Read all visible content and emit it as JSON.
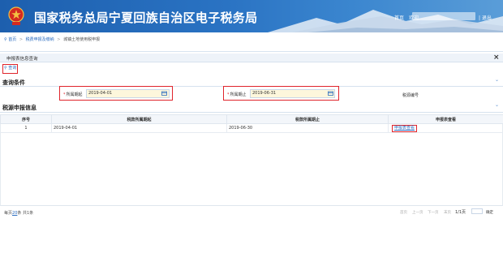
{
  "header": {
    "title": "国家税务总局宁夏回族自治区电子税务局",
    "nav_home": "首页",
    "nav_user": "欢迎",
    "nav_exit": "| 退出"
  },
  "breadcrumb": {
    "items": [
      "首页",
      "税费申报及缴纳",
      "城镇土地使用税申报"
    ]
  },
  "panel": {
    "title": "申报表信息查询",
    "close": "×",
    "query_button": "查询"
  },
  "query": {
    "section_title": "查询条件",
    "start_label": "所属期起",
    "start_value": "2019-04-01",
    "end_label": "所属期止",
    "end_value": "2019-06-31",
    "tax_no_label": "税源编号"
  },
  "results": {
    "section_title": "税源申报信息",
    "columns": [
      "序号",
      "税款所属期起",
      "税款所属期止",
      "申报表查看"
    ],
    "rows": [
      {
        "index": "1",
        "start": "2019-04-01",
        "end": "2019-06-30",
        "action": "申报表查看"
      }
    ]
  },
  "pager": {
    "per_page_prefix": "每页",
    "per_page": "20",
    "per_page_suffix": "条 共1条",
    "first": "首页",
    "prev": "上一页",
    "next": "下一页",
    "last": "末页",
    "page_info": "1/1页",
    "go": "确定"
  },
  "colors": {
    "header_blue": "#2a73c3",
    "highlight_red": "#e0242b",
    "link_blue": "#2a6cc0"
  }
}
